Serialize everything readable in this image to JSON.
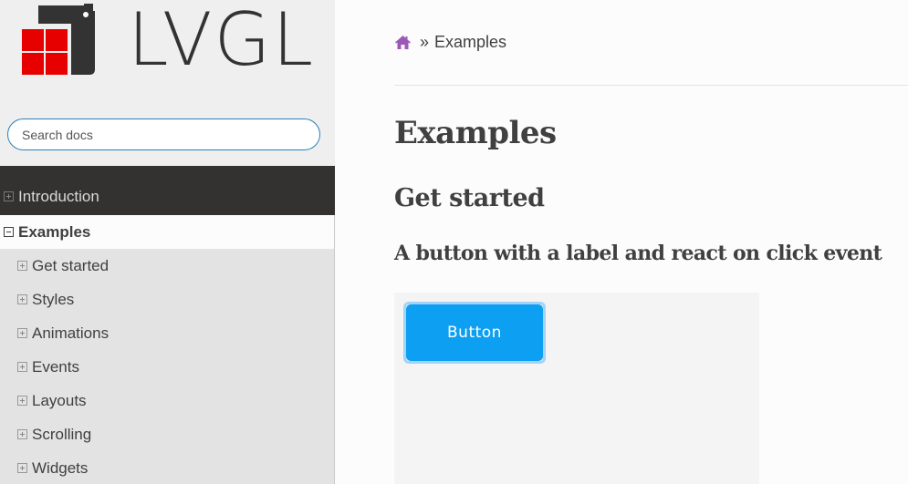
{
  "logo": {
    "text": "LVGL",
    "colors": {
      "red": "#e60000",
      "dark": "#333333"
    }
  },
  "search": {
    "placeholder": "Search docs",
    "value": ""
  },
  "nav": {
    "items": [
      {
        "label": "Introduction",
        "level": 1,
        "expanded": false
      },
      {
        "label": "Examples",
        "level": 1,
        "expanded": true,
        "current": true
      },
      {
        "label": "Get started",
        "level": 2
      },
      {
        "label": "Styles",
        "level": 2
      },
      {
        "label": "Animations",
        "level": 2
      },
      {
        "label": "Events",
        "level": 2
      },
      {
        "label": "Layouts",
        "level": 2
      },
      {
        "label": "Scrolling",
        "level": 2
      },
      {
        "label": "Widgets",
        "level": 2
      }
    ]
  },
  "breadcrumb": {
    "icon": "home-icon",
    "separator": "»",
    "current": "Examples"
  },
  "content": {
    "title": "Examples",
    "section": "Get started",
    "subsection": "A button with a label and react on click event",
    "demo": {
      "button_label": "Button"
    }
  },
  "colors": {
    "accent": "#2980b9",
    "home_icon": "#9b59b6",
    "demo_button": "#0c9ff2",
    "sidebar_dark": "#343131"
  }
}
